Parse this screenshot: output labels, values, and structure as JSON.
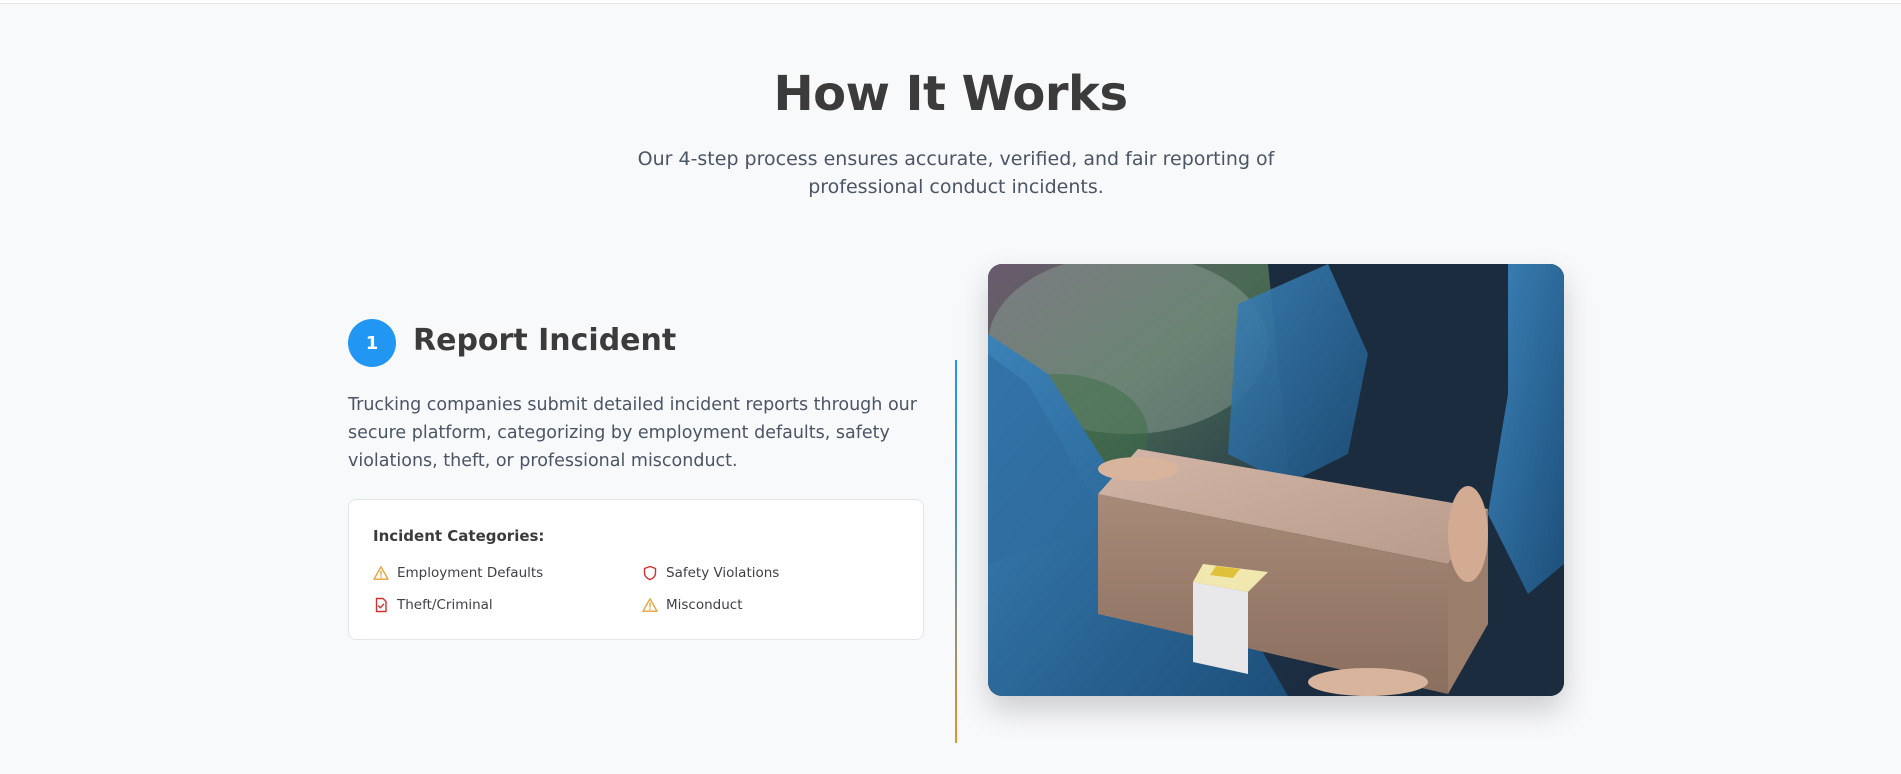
{
  "section": {
    "title": "How It Works",
    "subtitle": "Our 4-step process ensures accurate, verified, and fair reporting of professional conduct incidents."
  },
  "step": {
    "number": "1",
    "title": "Report Incident",
    "description": "Trucking companies submit detailed incident reports through our secure platform, categorizing by employment defaults, safety violations, theft, or professional misconduct."
  },
  "categories": {
    "heading": "Incident Categories:",
    "items": [
      {
        "label": "Employment Defaults",
        "icon": "warning-triangle-icon",
        "color": "#e6a23c"
      },
      {
        "label": "Safety Violations",
        "icon": "shield-icon",
        "color": "#d32f2f"
      },
      {
        "label": "Theft/Criminal",
        "icon": "document-check-icon",
        "color": "#d32f2f"
      },
      {
        "label": "Misconduct",
        "icon": "warning-triangle-icon",
        "color": "#e6a23c"
      }
    ]
  },
  "colors": {
    "accent": "#2196f3",
    "warning": "#e6a23c",
    "danger": "#d32f2f",
    "timeline_end": "#e8912a"
  }
}
